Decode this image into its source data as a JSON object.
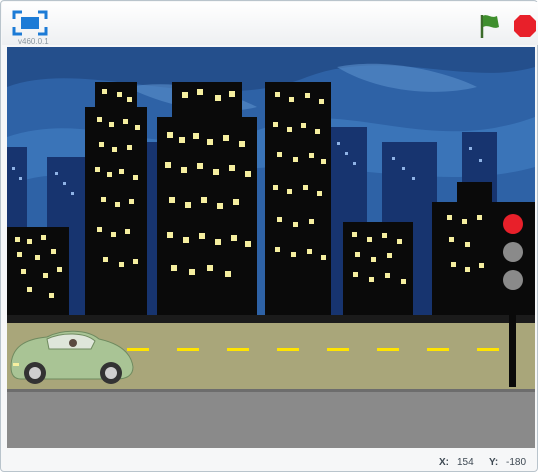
{
  "toolbar": {
    "version_text": "v460.0.1",
    "fullscreen_icon": "fullscreen-icon",
    "green_flag_icon": "green-flag-icon",
    "stop_icon": "stop-sign-icon",
    "colors": {
      "accent": "#1c7bd6",
      "flag": "#3f8f2e",
      "stop": "#e8202a"
    }
  },
  "stage": {
    "backdrop": "city-street-night",
    "sprites": [
      "car",
      "traffic-light"
    ],
    "traffic_light_state": "red",
    "colors": {
      "sky": "#2f5fa0",
      "road": "#a9a67a",
      "lane_marking": "#ffe400",
      "sidewalk": "#8a8a8a",
      "window": "#f6efa0"
    }
  },
  "coordinates": {
    "x_label": "X:",
    "x_value": "154",
    "y_label": "Y:",
    "y_value": "-180"
  }
}
